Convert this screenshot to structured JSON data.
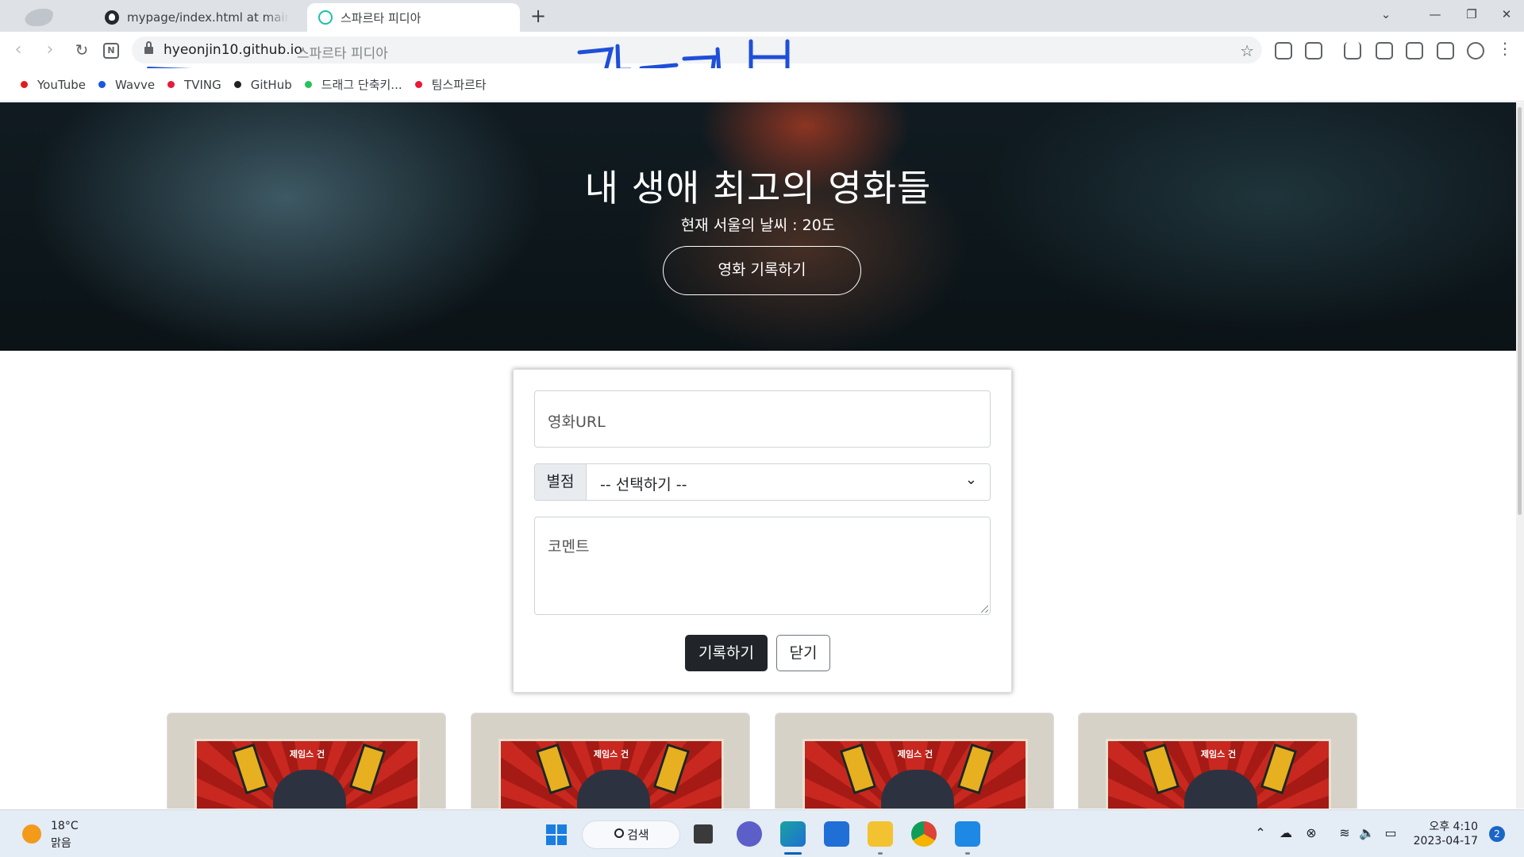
{
  "browser": {
    "tabs": [
      {
        "title": "mypage/index.html at main · hy",
        "active": false
      },
      {
        "title": "스파르타 피디아",
        "active": true
      }
    ],
    "new_tab_symbol": "+",
    "url_host": "hyeonjin10.github.io",
    "url_title": "스파르타 피디아",
    "annotation_text": "갓커브"
  },
  "bookmarks": [
    {
      "label": "YouTube",
      "color": "#e21b1b"
    },
    {
      "label": "Wavve",
      "color": "#1a55e6"
    },
    {
      "label": "TVING",
      "color": "#e8193b"
    },
    {
      "label": "GitHub",
      "color": "#222222"
    },
    {
      "label": "드래그 단축키...",
      "color": "#27c25a"
    },
    {
      "label": "팀스파르타",
      "color": "#e8193b"
    }
  ],
  "hero": {
    "title": "내 생애 최고의 영화들",
    "weather": "현재 서울의 날씨 : 20도",
    "button_label": "영화 기록하기"
  },
  "form": {
    "url_placeholder": "영화URL",
    "star_label": "별점",
    "star_selected": "-- 선택하기 --",
    "comment_placeholder": "코멘트",
    "submit_label": "기록하기",
    "close_label": "닫기"
  },
  "cards": [
    {
      "poster_title": "제임스 건"
    },
    {
      "poster_title": "제임스 건"
    },
    {
      "poster_title": "제임스 건"
    },
    {
      "poster_title": "제임스 건"
    }
  ],
  "taskbar": {
    "temperature": "18°C",
    "weather_desc": "맑음",
    "search_label": "검색",
    "time": "오후 4:10",
    "date": "2023-04-17",
    "notifications": "2"
  },
  "colors": {
    "accent_annotation": "#1f4fd8",
    "primary_button": "#212529"
  }
}
